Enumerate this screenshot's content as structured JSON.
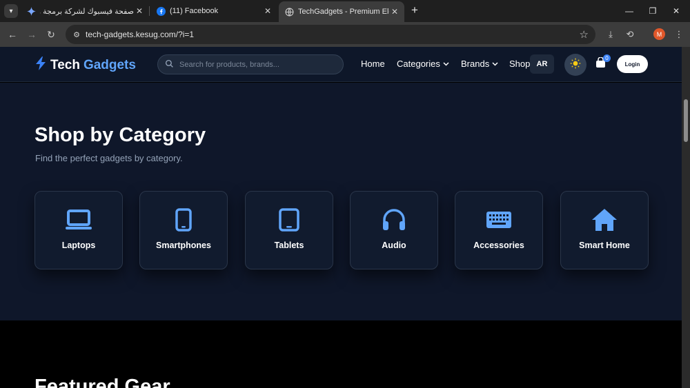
{
  "browser": {
    "tabs": [
      {
        "title": "صفحة فيسبوك لشركة برمجة وتص",
        "icon": "gemini-sparkle-icon"
      },
      {
        "title": "(11) Facebook",
        "icon": "facebook-icon"
      },
      {
        "title": "TechGadgets - Premium Electro",
        "icon": "globe-icon"
      }
    ],
    "url": "tech-gadgets.kesug.com/?i=1",
    "profile_initial": "M"
  },
  "header": {
    "logo_word1": "Tech",
    "logo_word2": "Gadgets",
    "search_placeholder": "Search for products, brands...",
    "nav": {
      "home": "Home",
      "categories": "Categories",
      "brands": "Brands",
      "shop": "Shop"
    },
    "lang": "AR",
    "cart_count": "0",
    "login": "Login"
  },
  "categories_section": {
    "title": "Shop by Category",
    "subtitle": "Find the perfect gadgets by category.",
    "items": [
      {
        "label": "Laptops",
        "icon": "laptop-icon"
      },
      {
        "label": "Smartphones",
        "icon": "smartphone-icon"
      },
      {
        "label": "Tablets",
        "icon": "tablet-icon"
      },
      {
        "label": "Audio",
        "icon": "headphones-icon"
      },
      {
        "label": "Accessories",
        "icon": "keyboard-icon"
      },
      {
        "label": "Smart Home",
        "icon": "home-icon"
      }
    ]
  },
  "featured": {
    "title": "Featured Gear"
  },
  "colors": {
    "accent": "#3b82f6",
    "accent_light": "#60a5fa",
    "section_bg": "#0f172a",
    "card_bg": "#111b2e"
  }
}
